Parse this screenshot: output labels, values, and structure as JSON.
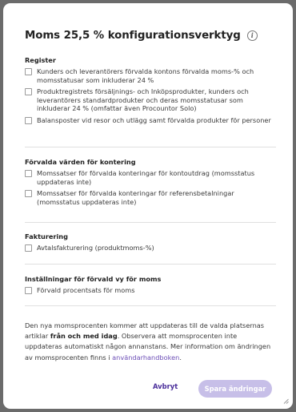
{
  "dialog": {
    "title": "Moms 25,5 % konfigurationsverktyg",
    "info_icon_glyph": "i"
  },
  "sections": {
    "register": {
      "title": "Register",
      "options": [
        "Kunders och leverantörers förvalda kontons förvalda moms-% och momsstatusar som inkluderar 24 %",
        "Produktregistrets försäljnings- och Inköpsprodukter, kunders och leverantörers standardprodukter och deras momsstatusar som inkluderar 24 % (omfattar även Procountor Solo)",
        "Balansposter vid resor och utlägg samt förvalda produkter för personer"
      ]
    },
    "kontering": {
      "title": "Förvalda värden för kontering",
      "options": [
        "Momssatser för förvalda konteringar för kontoutdrag (momsstatus uppdateras inte)",
        "Momssatser för förvalda konteringar för referensbetalningar (momsstatus uppdateras inte)"
      ]
    },
    "fakturering": {
      "title": "Fakturering",
      "options": [
        "Avtalsfakturering (produktmoms-%)"
      ]
    },
    "installningar": {
      "title": "Inställningar för förvald vy för moms",
      "options": [
        "Förvald procentsats för moms"
      ]
    }
  },
  "info": {
    "text_before": "Den nya momsprocenten kommer att uppdateras till de valda platsernas artiklar ",
    "bold": "från och med idag",
    "text_after": ". Observera att momsprocenten inte uppdateras automatiskt någon annanstans. Mer information om ändringen av momsprocenten finns i ",
    "link": "användarhandboken",
    "end": "."
  },
  "buttons": {
    "cancel": "Avbryt",
    "save": "Spara ändringar"
  },
  "colors": {
    "accent": "#4b2f9b",
    "save_disabled_bg": "#c7bfe8",
    "link": "#6d4fb7"
  }
}
